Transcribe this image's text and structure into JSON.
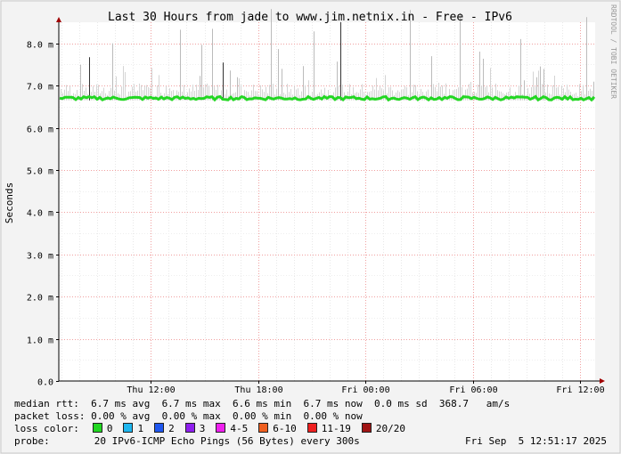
{
  "chart_data": {
    "type": "line",
    "title": "Last 30 Hours from jade to www.jim.netnix.in - Free - IPv6",
    "ylabel": "Seconds",
    "ylim": [
      0,
      0.0085
    ],
    "y_ticks": [
      {
        "value": 0.0,
        "label": "0.0"
      },
      {
        "value": 0.001,
        "label": "1.0 m"
      },
      {
        "value": 0.002,
        "label": "2.0 m"
      },
      {
        "value": 0.003,
        "label": "3.0 m"
      },
      {
        "value": 0.004,
        "label": "4.0 m"
      },
      {
        "value": 0.005,
        "label": "5.0 m"
      },
      {
        "value": 0.006,
        "label": "6.0 m"
      },
      {
        "value": 0.007,
        "label": "7.0 m"
      },
      {
        "value": 0.008,
        "label": "8.0 m"
      }
    ],
    "xlim": [
      "Thu 06:51",
      "Fri 12:51"
    ],
    "x_ticks": [
      {
        "label": "Thu 12:00",
        "hours": 5.15
      },
      {
        "label": "Thu 18:00",
        "hours": 11.15
      },
      {
        "label": "Fri 00:00",
        "hours": 17.15
      },
      {
        "label": "Fri 06:00",
        "hours": 23.15
      },
      {
        "label": "Fri 12:00",
        "hours": 29.15
      }
    ],
    "grid": true,
    "watermark": "RRDTOOL / TOBI OETIKER",
    "series": [
      {
        "name": "median rtt",
        "color": "#22d722",
        "approx_value": 0.0067
      }
    ]
  },
  "stats": {
    "median_rtt": "median rtt:  6.7 ms avg  6.7 ms max  6.6 ms min  6.7 ms now  0.0 ms sd  368.7   am/s",
    "packet_loss": "packet loss: 0.00 % avg  0.00 % max  0.00 % min  0.00 % now",
    "loss_color_label": "loss color:",
    "loss_legend": [
      {
        "label": "0",
        "color": "#22d722"
      },
      {
        "label": "1",
        "color": "#1fb7ef"
      },
      {
        "label": "2",
        "color": "#1f57ef"
      },
      {
        "label": "3",
        "color": "#8f1fef"
      },
      {
        "label": "4-5",
        "color": "#ef1fef"
      },
      {
        "label": "6-10",
        "color": "#ef5f1f"
      },
      {
        "label": "11-19",
        "color": "#ef1f1f"
      },
      {
        "label": "20/20",
        "color": "#a01414"
      }
    ],
    "probe_label": "probe:",
    "probe_text": "20 IPv6-ICMP Echo Pings (56 Bytes) every 300s",
    "timestamp": "Fri Sep  5 12:51:17 2025"
  }
}
